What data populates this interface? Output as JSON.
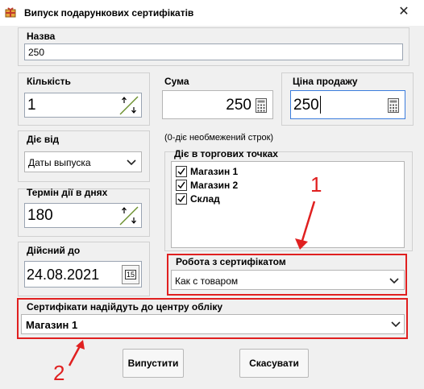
{
  "window": {
    "title": "Випуск подарункових сертифікатів",
    "close_glyph": "✕"
  },
  "name": {
    "label": "Назва",
    "value": "250"
  },
  "quantity": {
    "label": "Кількість",
    "value": "1"
  },
  "sum": {
    "label": "Сума",
    "value": "250"
  },
  "sale_price": {
    "label": "Ціна продажу",
    "value": "250"
  },
  "valid_from": {
    "label": "Діє від",
    "value": "Даты выпуска"
  },
  "term_note": "(0-діє необмежений строк)",
  "term": {
    "label": "Термін дії в днях",
    "value": "180"
  },
  "valid_until": {
    "label": "Дійсний до",
    "value": "24.08.2021",
    "calendar_day": "15"
  },
  "stores": {
    "label": "Діє в торгових точках",
    "items": [
      {
        "label": "Магазин 1",
        "checked": true
      },
      {
        "label": "Магазин 2",
        "checked": true
      },
      {
        "label": "Склад",
        "checked": true
      }
    ]
  },
  "cert_work": {
    "label": "Робота з сертифікатом",
    "value": "Как с товаром"
  },
  "center": {
    "label": "Сертифікати надійдуть до центру обліку",
    "value": "Магазин 1"
  },
  "annotations": {
    "one": "1",
    "two": "2"
  },
  "buttons": {
    "issue": "Випустити",
    "cancel": "Скасувати"
  },
  "icons": {
    "app": "gift-app-icon",
    "spin": "spin-up-down-icon",
    "calc": "calculator-icon",
    "calendar": "calendar-icon",
    "combo": "chevron-down-icon",
    "check": "checkmark-icon"
  },
  "colors": {
    "highlight": "#e02020",
    "focus_border": "#3b7ddd",
    "window_bg": "#f0f0f0"
  }
}
